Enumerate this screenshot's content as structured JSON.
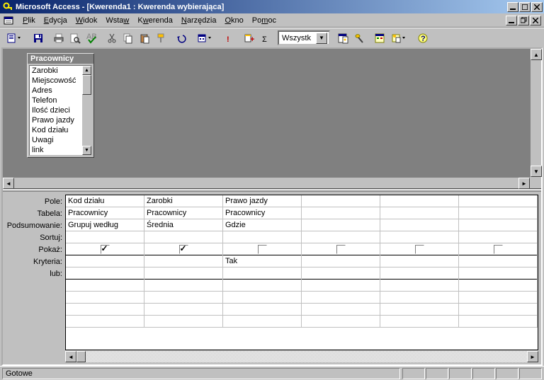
{
  "title": "Microsoft Access - [Kwerenda1 : Kwerenda wybierająca]",
  "menu": {
    "items": [
      {
        "label": "Plik",
        "u": 0
      },
      {
        "label": "Edycja",
        "u": 0
      },
      {
        "label": "Widok",
        "u": 0
      },
      {
        "label": "Wstaw",
        "u": 4
      },
      {
        "label": "Kwerenda",
        "u": 1
      },
      {
        "label": "Narzędzia",
        "u": 0
      },
      {
        "label": "Okno",
        "u": 0
      },
      {
        "label": "Pomoc",
        "u": 2
      }
    ]
  },
  "toolbar": {
    "combo_value": "Wszystk"
  },
  "table_list": {
    "title": "Pracownicy",
    "fields": [
      "Zarobki",
      "Miejscowość",
      "Adres",
      "Telefon",
      "Ilość dzieci",
      "Prawo jazdy",
      "Kod działu",
      "Uwagi",
      "link"
    ]
  },
  "design_grid": {
    "row_labels": [
      "Pole:",
      "Tabela:",
      "Podsumowanie:",
      "Sortuj:",
      "Pokaż:",
      "Kryteria:",
      "lub:"
    ],
    "columns": [
      {
        "pole": "Kod działu",
        "tabela": "Pracownicy",
        "pods": "Grupuj według",
        "sortuj": "",
        "pokaz": true,
        "kryteria": "",
        "lub": ""
      },
      {
        "pole": "Zarobki",
        "tabela": "Pracownicy",
        "pods": "Średnia",
        "sortuj": "",
        "pokaz": true,
        "kryteria": "",
        "lub": ""
      },
      {
        "pole": "Prawo jazdy",
        "tabela": "Pracownicy",
        "pods": "Gdzie",
        "sortuj": "",
        "pokaz": false,
        "kryteria": "Tak",
        "lub": ""
      },
      {
        "pole": "",
        "tabela": "",
        "pods": "",
        "sortuj": "",
        "pokaz": false,
        "kryteria": "",
        "lub": ""
      },
      {
        "pole": "",
        "tabela": "",
        "pods": "",
        "sortuj": "",
        "pokaz": false,
        "kryteria": "",
        "lub": ""
      },
      {
        "pole": "",
        "tabela": "",
        "pods": "",
        "sortuj": "",
        "pokaz": false,
        "kryteria": "",
        "lub": ""
      }
    ]
  },
  "status": "Gotowe"
}
